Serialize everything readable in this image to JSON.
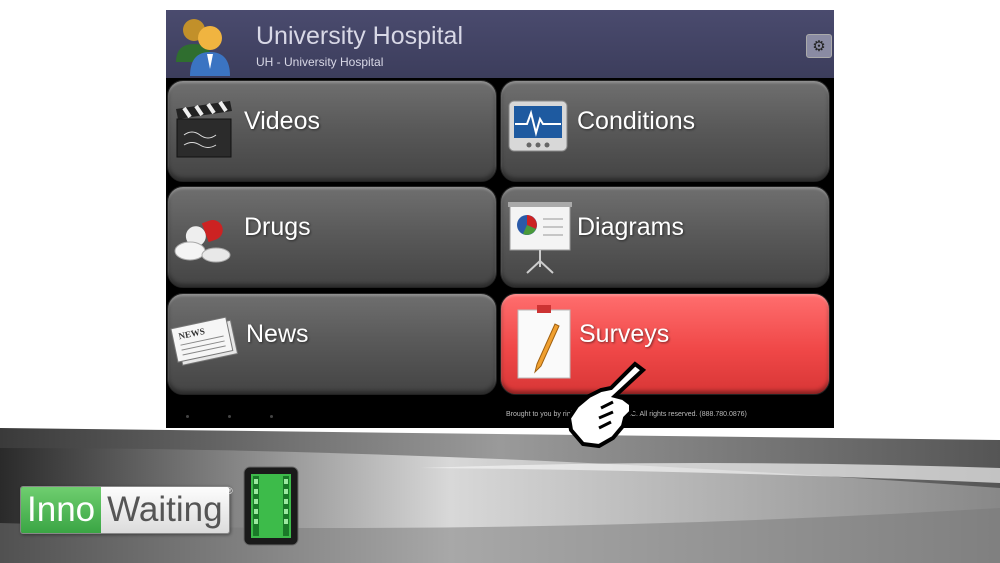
{
  "header": {
    "title": "University Hospital",
    "subtitle": "UH - University Hospital",
    "settings_icon": "gear-icon"
  },
  "menu": [
    {
      "label": "Videos",
      "icon": "clapperboard-icon",
      "active": false
    },
    {
      "label": "Conditions",
      "icon": "heart-monitor-icon",
      "active": false
    },
    {
      "label": "Drugs",
      "icon": "pills-icon",
      "active": false
    },
    {
      "label": "Diagrams",
      "icon": "presentation-easel-icon",
      "active": false
    },
    {
      "label": "News",
      "icon": "newspaper-icon",
      "active": false
    },
    {
      "label": "Surveys",
      "icon": "clipboard-pencil-icon",
      "active": true
    }
  ],
  "footer": {
    "text": "Brought to you by                  right 2012 Dawazu LLC. All rights reserved. (888.780.0876)"
  },
  "branding": {
    "brand_part1": "Inno",
    "brand_part2": "Waiting",
    "registered": "®",
    "tablet_icon": "tablet-film-icon",
    "cursor_icon": "pointing-hand-cursor-icon"
  },
  "colors": {
    "header_bg": "#42435f",
    "tile_bg": "#5a5a5a",
    "active_tile_bg": "#f04848",
    "brand_green": "#3aa544"
  }
}
